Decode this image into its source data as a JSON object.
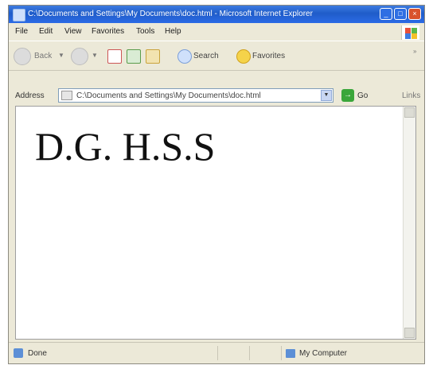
{
  "window": {
    "title": "C:\\Documents and Settings\\My Documents\\doc.html - Microsoft Internet Explorer",
    "controls": [
      "_",
      "□",
      "×"
    ]
  },
  "menubar": {
    "items": [
      "File",
      "Edit",
      "View",
      "Favorites",
      "Tools",
      "Help"
    ]
  },
  "toolbar": {
    "back_label": "Back",
    "search_label": "Search",
    "favorites_label": "Favorites"
  },
  "addressbar": {
    "label": "Address",
    "url": "C:\\Documents and Settings\\My Documents\\doc.html",
    "go_label": "Go",
    "links_label": "Links"
  },
  "page": {
    "heading": "D.G. H.S.S"
  },
  "statusbar": {
    "status": "Done",
    "zone": "My Computer"
  },
  "colors": {
    "titlebar": "#2b6be6",
    "chrome": "#ece9d8",
    "go_button": "#3aa63a"
  }
}
